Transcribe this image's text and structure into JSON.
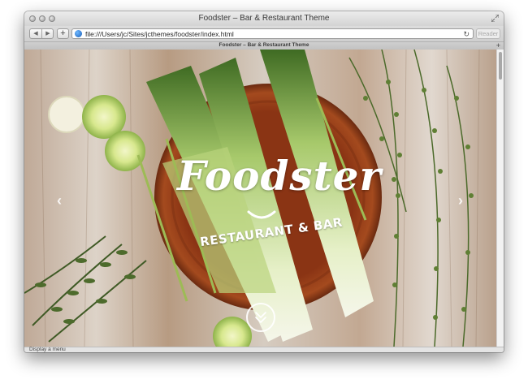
{
  "browser": {
    "window_title": "Foodster – Bar & Restaurant Theme",
    "url": "file:///Users/jc/Sites/jcthemes/foodster/index.html",
    "tab_title": "Foodster – Bar & Restaurant Theme",
    "reader_label": "Reader",
    "back_icon": "◀",
    "forward_icon": "▶",
    "add_icon": "+",
    "reload_icon": "↻",
    "new_tab_icon": "+",
    "status_text": "Display a menu"
  },
  "hero": {
    "brand": "Foodster",
    "subtitle": "RESTAURANT & BAR",
    "prev_icon": "‹",
    "next_icon": "›"
  },
  "icons": {
    "globe": "globe-icon",
    "scroll_down": "double-chevron-down-icon",
    "smile": "smile-icon"
  },
  "colors": {
    "background_wood": "#cbbfb4",
    "board": "#8c3a16",
    "leek_green": "#c9e08a"
  }
}
